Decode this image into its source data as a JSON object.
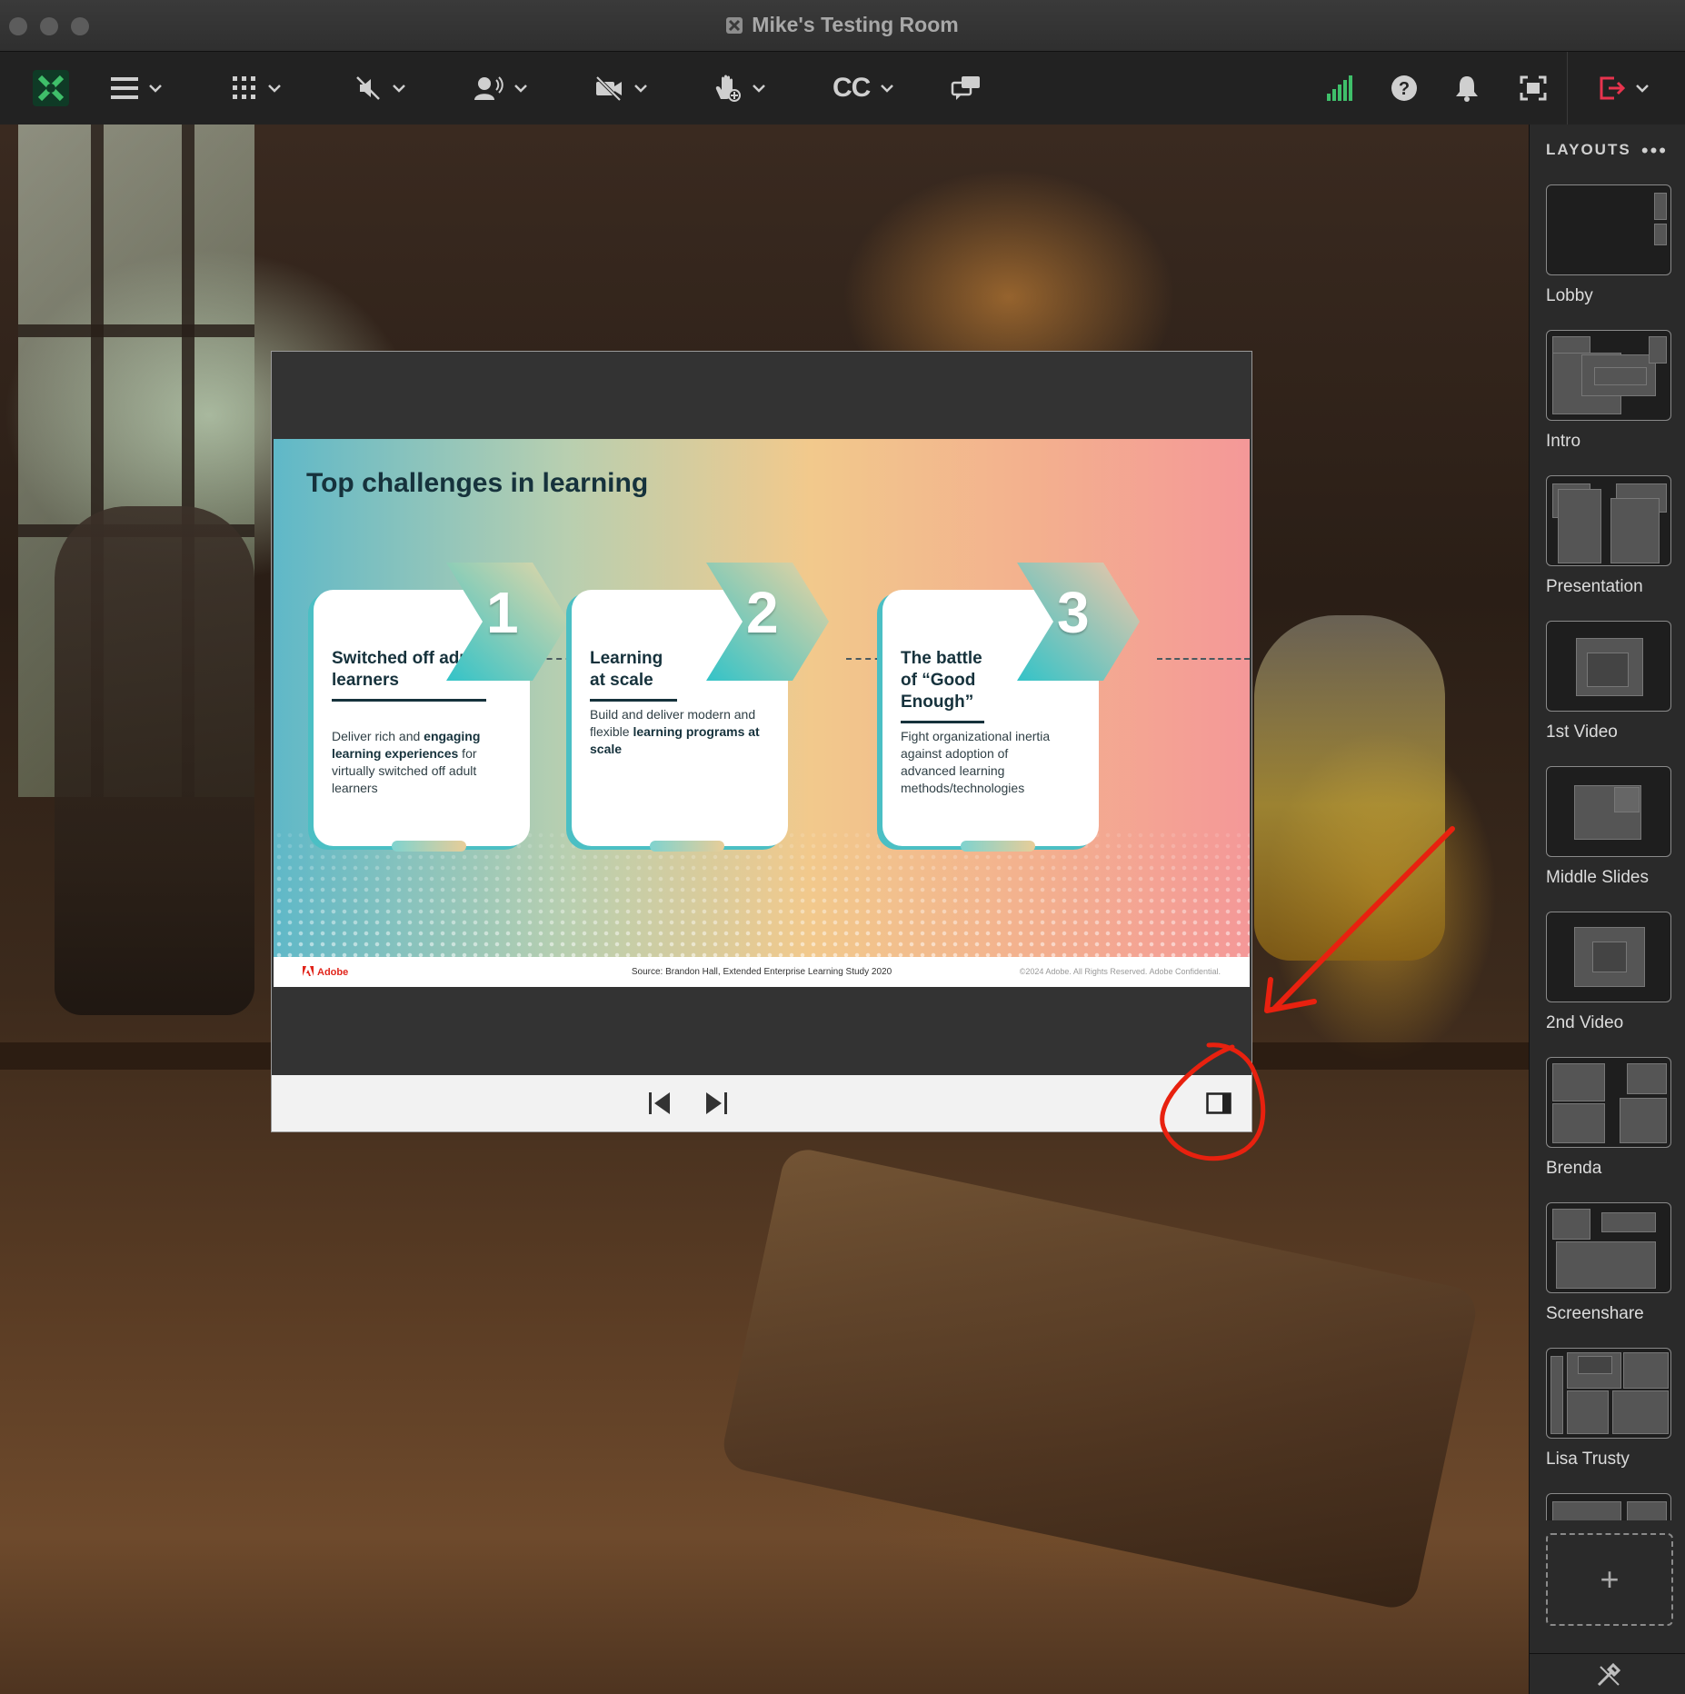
{
  "window": {
    "title": "Mike's Testing Room"
  },
  "toolbar": {
    "items": [
      {
        "icon": "app-logo-icon"
      },
      {
        "icon": "menu-icon"
      },
      {
        "icon": "apps-grid-icon"
      },
      {
        "icon": "speaker-muted-icon"
      },
      {
        "icon": "microphone-icon"
      },
      {
        "icon": "camera-off-icon"
      },
      {
        "icon": "raise-hand-icon"
      },
      {
        "icon": "closed-captions-icon",
        "label": "CC"
      },
      {
        "icon": "chat-bubbles-icon"
      },
      {
        "icon": "signal-strength-icon"
      },
      {
        "icon": "help-icon"
      },
      {
        "icon": "notification-bell-icon"
      },
      {
        "icon": "fullscreen-icon"
      },
      {
        "icon": "exit-icon"
      }
    ]
  },
  "slide": {
    "title": "Top challenges in learning",
    "cards": [
      {
        "number": "1",
        "title": "Switched off adult learners",
        "body_pre": "Deliver rich and ",
        "body_bold": "engaging learning experiences",
        "body_post": " for virtually switched off adult learners"
      },
      {
        "number": "2",
        "title": "Learning at scale",
        "body_pre": "Build and deliver modern and flexible ",
        "body_bold": "learning programs at scale",
        "body_post": ""
      },
      {
        "number": "3",
        "title": "The battle of “Good Enough”",
        "body_pre": "Fight organizational inertia against adoption of advanced learning methods/technologies",
        "body_bold": "",
        "body_post": ""
      }
    ],
    "footer": {
      "brand": "Adobe",
      "source": "Source: Brandon Hall, Extended Enterprise Learning Study 2020",
      "copyright": "©2024 Adobe. All Rights Reserved. Adobe Confidential."
    }
  },
  "pod_controls": {
    "prev_icon": "skip-previous-icon",
    "next_icon": "skip-next-icon",
    "sidebar_icon": "sidebar-toggle-icon"
  },
  "layouts": {
    "header": "LAYOUTS",
    "more": "•••",
    "items": [
      {
        "label": "Lobby"
      },
      {
        "label": "Intro"
      },
      {
        "label": "Presentation"
      },
      {
        "label": "1st Video"
      },
      {
        "label": "Middle Slides"
      },
      {
        "label": "2nd Video"
      },
      {
        "label": "Brenda"
      },
      {
        "label": "Screenshare"
      },
      {
        "label": "Lisa Trusty"
      }
    ],
    "add": "+"
  },
  "colors": {
    "accent_green": "#3fbf6a",
    "exit_red": "#e8344e",
    "annotation_red": "#e8210f"
  }
}
